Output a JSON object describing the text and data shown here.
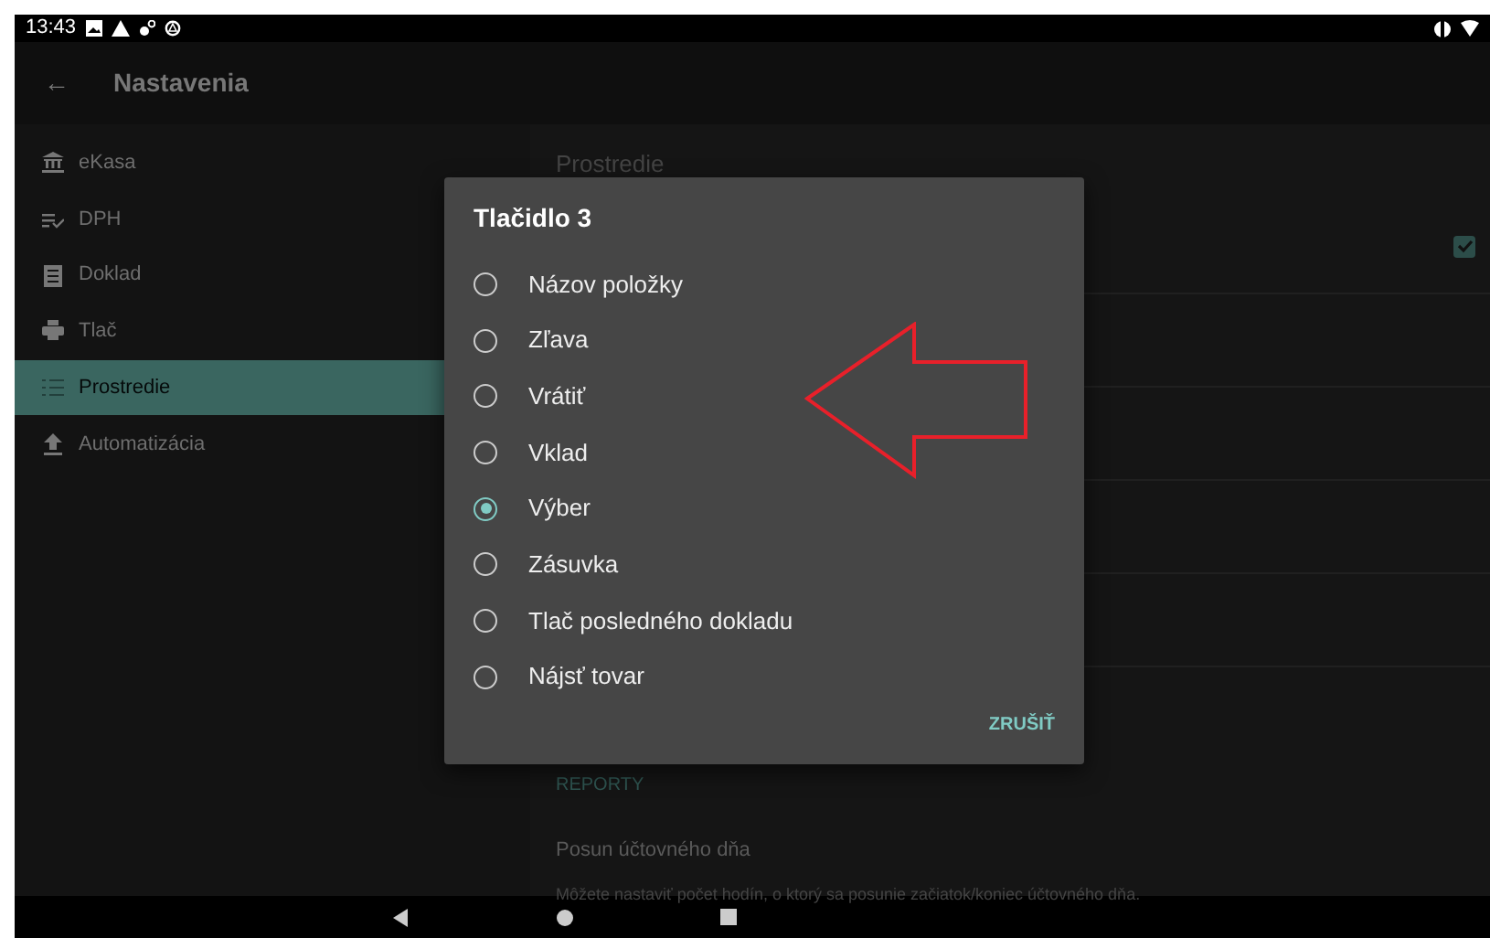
{
  "status_bar": {
    "time": "13:43"
  },
  "app_bar": {
    "back_icon": "←",
    "title": "Nastavenia"
  },
  "sidebar": {
    "items": [
      {
        "label": "eKasa",
        "kind": "bank",
        "selected": false
      },
      {
        "label": "DPH",
        "kind": "checklist",
        "selected": false
      },
      {
        "label": "Doklad",
        "kind": "document",
        "selected": false
      },
      {
        "label": "Tlač",
        "kind": "printer",
        "selected": false
      },
      {
        "label": "Prostredie",
        "kind": "list",
        "selected": true
      },
      {
        "label": "Automatizácia",
        "kind": "upload",
        "selected": false
      }
    ]
  },
  "content": {
    "title": "Prostredie",
    "checkbox": {
      "checked": true
    },
    "section": "REPORTY",
    "setting": {
      "title": "Posun účtovného dňa",
      "summary": "Môžete nastaviť počet hodín, o ktorý sa posunie začiatok/koniec účtovného dňa."
    }
  },
  "dialog": {
    "title": "Tlačidlo 3",
    "options": [
      {
        "label": "Názov položky",
        "selected": false
      },
      {
        "label": "Zľava",
        "selected": false
      },
      {
        "label": "Vrátiť",
        "selected": false
      },
      {
        "label": "Vklad",
        "selected": false
      },
      {
        "label": "Výber",
        "selected": true
      },
      {
        "label": "Zásuvka",
        "selected": false
      },
      {
        "label": "Tlač posledného dokladu",
        "selected": false
      },
      {
        "label": "Nájsť tovar",
        "selected": false
      }
    ],
    "cancel": "ZRUŠIŤ"
  }
}
